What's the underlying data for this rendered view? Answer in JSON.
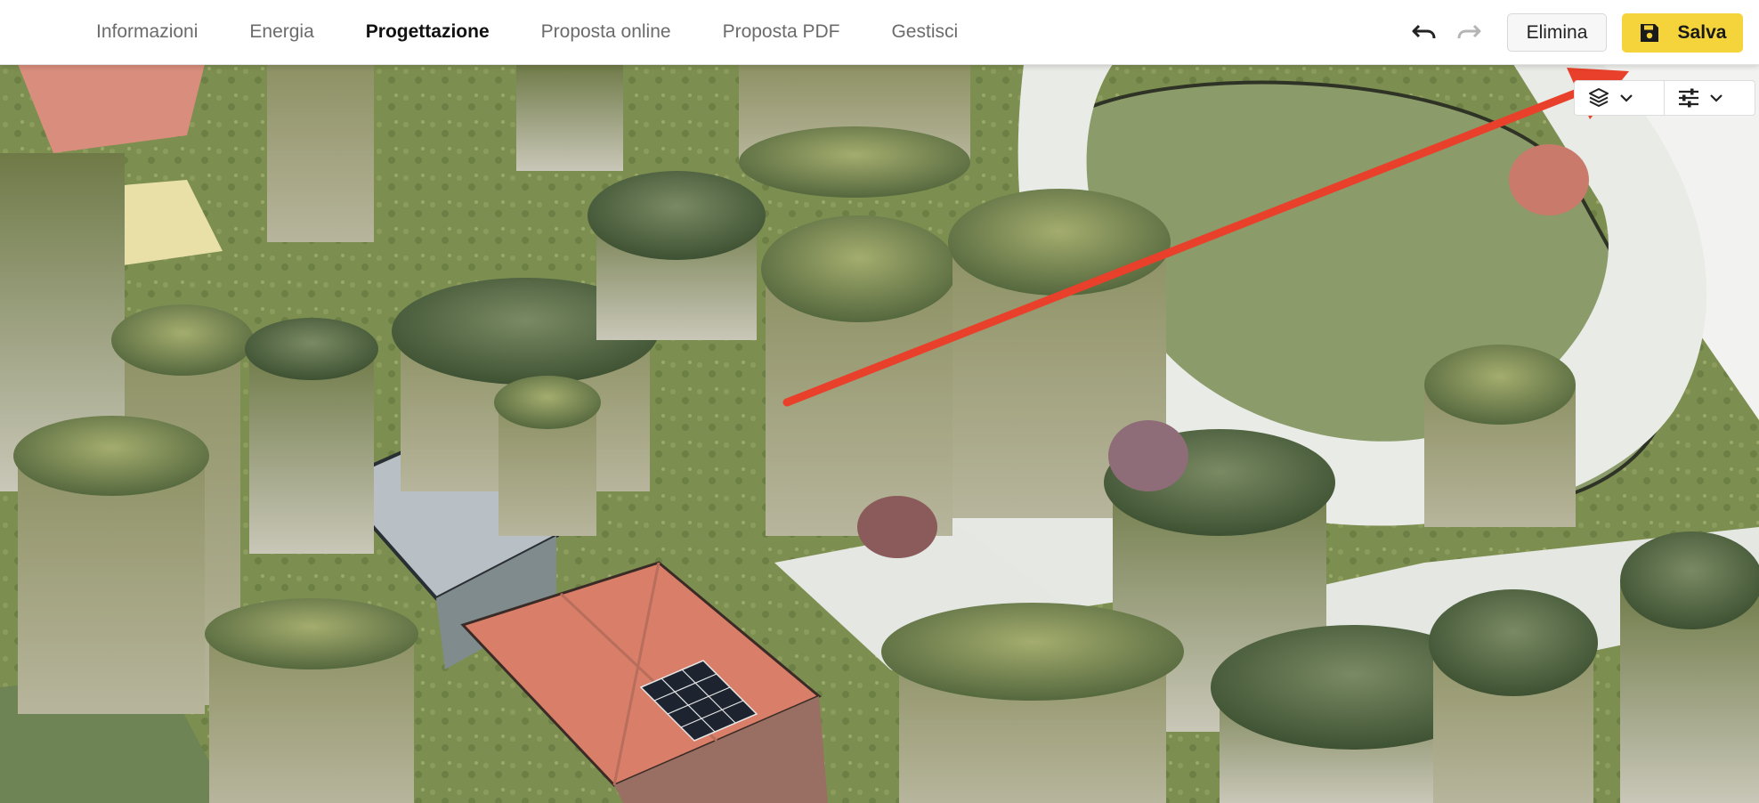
{
  "nav": {
    "tabs": [
      {
        "label": "Informazioni",
        "active": false
      },
      {
        "label": "Energia",
        "active": false
      },
      {
        "label": "Progettazione",
        "active": true
      },
      {
        "label": "Proposta online",
        "active": false
      },
      {
        "label": "Proposta PDF",
        "active": false
      },
      {
        "label": "Gestisci",
        "active": false
      }
    ]
  },
  "toolbar": {
    "undo_icon": "undo-icon",
    "redo_icon": "redo-icon",
    "delete_label": "Elimina",
    "save_label": "Salva",
    "save_icon": "floppy-disk-icon"
  },
  "map_controls": {
    "layers_icon": "layers-icon",
    "settings_icon": "sliders-icon",
    "dropdown_icon": "chevron-down-icon"
  },
  "annotation": {
    "arrow_color": "#e8402a"
  },
  "colors": {
    "accent": "#f5d33a",
    "roof": "#d97e68",
    "grass": "#7c8a4b",
    "path": "#e8eae5"
  }
}
